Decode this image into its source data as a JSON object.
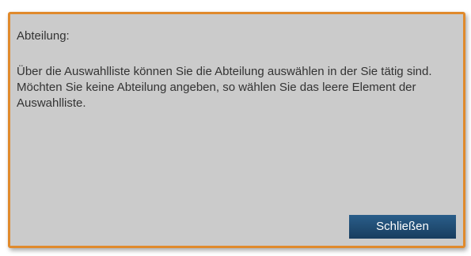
{
  "dialog": {
    "title": "Abteilung:",
    "body": "Über die Auswahlliste können Sie die Abteilung auswählen in der Sie tätig sind. Möchten Sie keine Abteilung angeben, so wählen Sie das leere Element der Auswahlliste.",
    "close_label": "Schließen"
  },
  "colors": {
    "border": "#e08a2c",
    "background": "#cbcbcb",
    "button": "#1f4a70"
  }
}
